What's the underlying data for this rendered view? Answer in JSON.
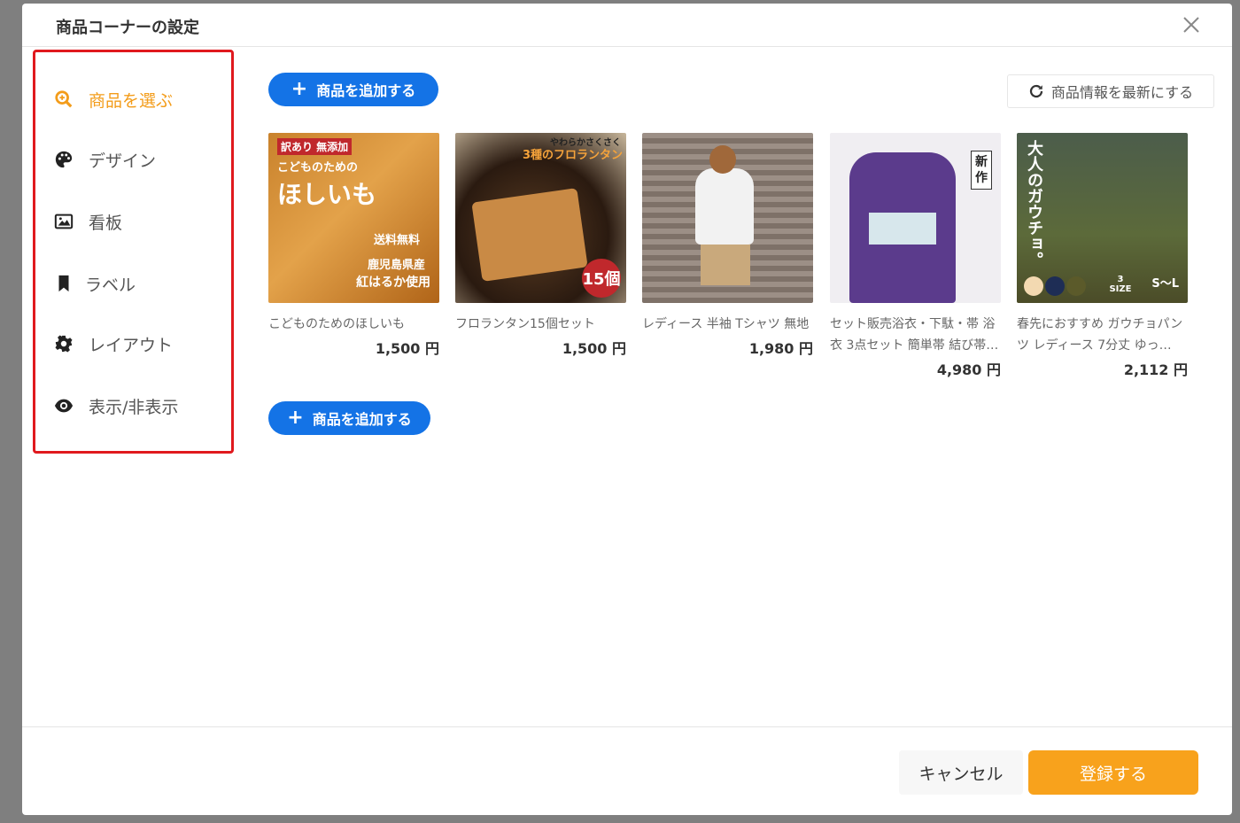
{
  "modal": {
    "title": "商品コーナーの設定"
  },
  "sidebar": {
    "items": [
      {
        "label": "商品を選ぶ",
        "icon": "search-plus-icon",
        "active": true
      },
      {
        "label": "デザイン",
        "icon": "palette-icon"
      },
      {
        "label": "看板",
        "icon": "image-icon"
      },
      {
        "label": "ラベル",
        "icon": "bookmark-icon"
      },
      {
        "label": "レイアウト",
        "icon": "gear-icon"
      },
      {
        "label": "表示/非表示",
        "icon": "eye-icon"
      }
    ]
  },
  "toolbar": {
    "add_label": "商品を追加する",
    "refresh_label": "商品情報を最新にする"
  },
  "products": [
    {
      "name": "こどものためのほしいも",
      "price": "1,500 円",
      "thumb_text": [
        "訳あり 無添加",
        "こどものための",
        "ほしいも",
        "送料無料",
        "鹿児島県産",
        "紅はるか使用"
      ]
    },
    {
      "name": "フロランタン15個セット",
      "price": "1,500 円",
      "thumb_text": [
        "やわらかさくさく",
        "3種のフロランタン",
        "15個"
      ]
    },
    {
      "name": "レディース 半袖 Tシャツ 無地",
      "price": "1,980 円",
      "thumb_text": []
    },
    {
      "name": "セット販売浴衣・下駄・帯 浴衣 3点セット 簡単帯 結び帯…",
      "price": "4,980 円",
      "thumb_text": [
        "新作"
      ]
    },
    {
      "name": "春先におすすめ ガウチョパンツ レディース 7分丈 ゆっ…",
      "price": "2,112 円",
      "thumb_text": [
        "大人のガウチョ。",
        "3 SIZE",
        "S〜L"
      ]
    }
  ],
  "footer": {
    "cancel_label": "キャンセル",
    "submit_label": "登録する"
  },
  "colors": {
    "accent": "#f39c1a",
    "primary": "#1473e6",
    "highlight": "#e0191e"
  }
}
